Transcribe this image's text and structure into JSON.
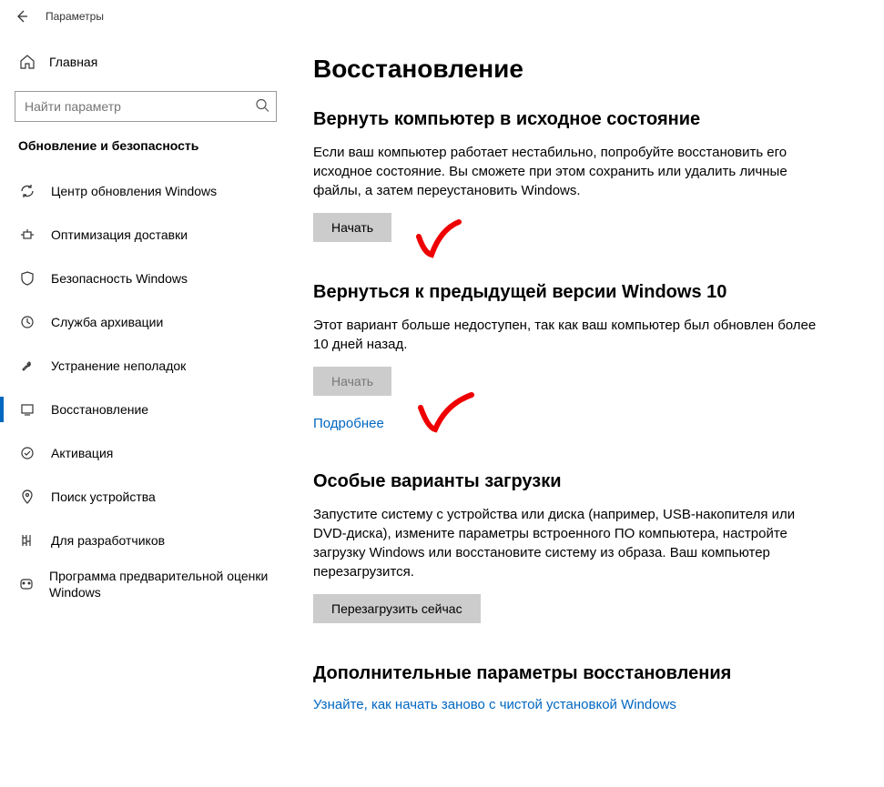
{
  "window": {
    "title": "Параметры"
  },
  "sidebar": {
    "home_label": "Главная",
    "search_placeholder": "Найти параметр",
    "section_title": "Обновление и безопасность",
    "items": [
      {
        "icon": "sync",
        "label": "Центр обновления Windows"
      },
      {
        "icon": "delivery",
        "label": "Оптимизация доставки"
      },
      {
        "icon": "shield",
        "label": "Безопасность Windows"
      },
      {
        "icon": "backup",
        "label": "Служба архивации"
      },
      {
        "icon": "troubleshoot",
        "label": "Устранение неполадок"
      },
      {
        "icon": "recovery",
        "label": "Восстановление",
        "selected": true
      },
      {
        "icon": "activation",
        "label": "Активация"
      },
      {
        "icon": "findmydevice",
        "label": "Поиск устройства"
      },
      {
        "icon": "developers",
        "label": "Для разработчиков"
      },
      {
        "icon": "insider",
        "label": "Программа предварительной оценки Windows"
      }
    ]
  },
  "page": {
    "title": "Восстановление",
    "reset": {
      "heading": "Вернуть компьютер в исходное состояние",
      "body": "Если ваш компьютер работает нестабильно, попробуйте восстановить его исходное состояние. Вы сможете при этом сохранить или удалить личные файлы, а затем переустановить Windows.",
      "button": "Начать"
    },
    "goback": {
      "heading": "Вернуться к предыдущей версии Windows 10",
      "body": "Этот вариант больше недоступен, так как ваш компьютер был обновлен более 10 дней назад.",
      "button": "Начать",
      "link": "Подробнее"
    },
    "advanced": {
      "heading": "Особые варианты загрузки",
      "body": "Запустите систему с устройства или диска (например, USB-накопителя или DVD-диска), измените параметры встроенного ПО компьютера, настройте загрузку Windows или восстановите систему из образа. Ваш компьютер перезагрузится.",
      "button": "Перезагрузить сейчас"
    },
    "more": {
      "heading": "Дополнительные параметры восстановления",
      "link": "Узнайте, как начать заново с чистой установкой Windows"
    }
  }
}
